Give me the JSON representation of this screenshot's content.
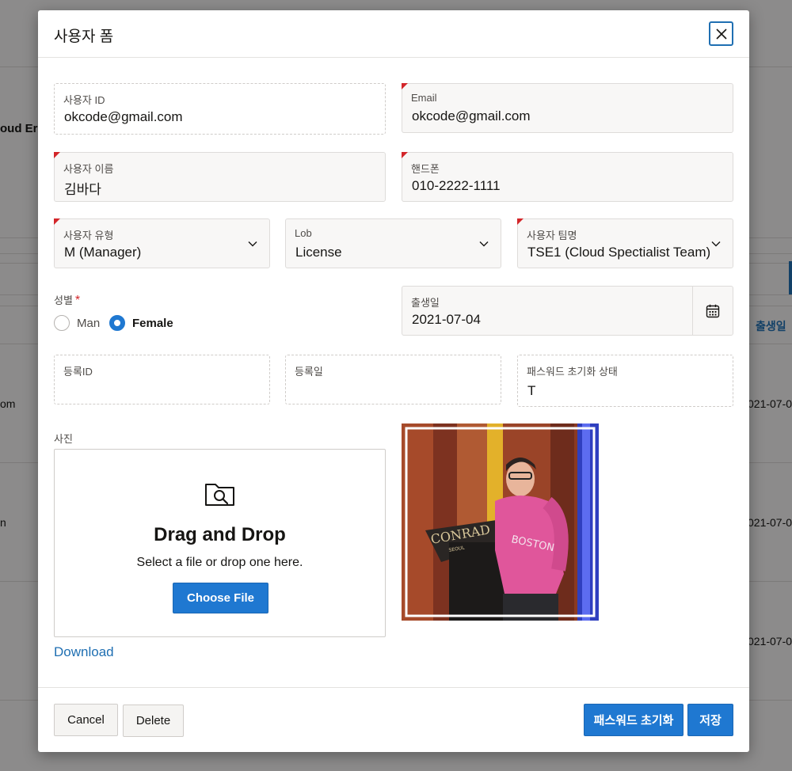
{
  "background": {
    "frag_cloud": "oud Er",
    "frag_birth_header": "출생일",
    "frag_rows": [
      {
        "left": "om",
        "right": "021-07-0"
      },
      {
        "left": "n",
        "right": "021-07-0"
      },
      {
        "left": "",
        "right": "021-07-0"
      }
    ]
  },
  "dialog": {
    "title": "사용자 폼",
    "close_icon": "close-icon"
  },
  "form": {
    "user_id": {
      "label": "사용자 ID",
      "value": "okcode@gmail.com"
    },
    "email": {
      "label": "Email",
      "value": "okcode@gmail.com"
    },
    "user_name": {
      "label": "사용자 이름",
      "value": "김바다"
    },
    "phone": {
      "label": "핸드폰",
      "value": "010-2222-1111"
    },
    "user_type": {
      "label": "사용자 유형",
      "value": "M (Manager)"
    },
    "lob": {
      "label": "Lob",
      "value": "License"
    },
    "team": {
      "label": "사용자 팀명",
      "value": "TSE1 (Cloud Spectialist Team)"
    },
    "gender": {
      "label": "성별",
      "required_mark": "*",
      "options": [
        {
          "label": "Man",
          "selected": false
        },
        {
          "label": "Female",
          "selected": true
        }
      ]
    },
    "birth": {
      "label": "출생일",
      "value": "2021-07-04",
      "icon": "calendar-icon"
    },
    "reg_id": {
      "label": "등록ID",
      "value": ""
    },
    "reg_date": {
      "label": "등록일",
      "value": ""
    },
    "pw_reset_status": {
      "label": "패스워드 초기화 상태",
      "value": "T"
    },
    "photo": {
      "label": "사진",
      "drop_title": "Drag and Drop",
      "drop_sub": "Select a file or drop one here.",
      "choose_label": "Choose File",
      "download_label": "Download",
      "preview_sign": "CONRAD",
      "preview_sign_sub": "SEOUL",
      "preview_shirt": "BOSTON"
    }
  },
  "footer": {
    "cancel_label": "Cancel",
    "delete_label": "Delete",
    "reset_pw_label": "패스워드 초기화",
    "save_label": "저장"
  },
  "colors": {
    "primary": "#1f78d1",
    "required": "#d3262a",
    "link": "#1f6fb2"
  }
}
